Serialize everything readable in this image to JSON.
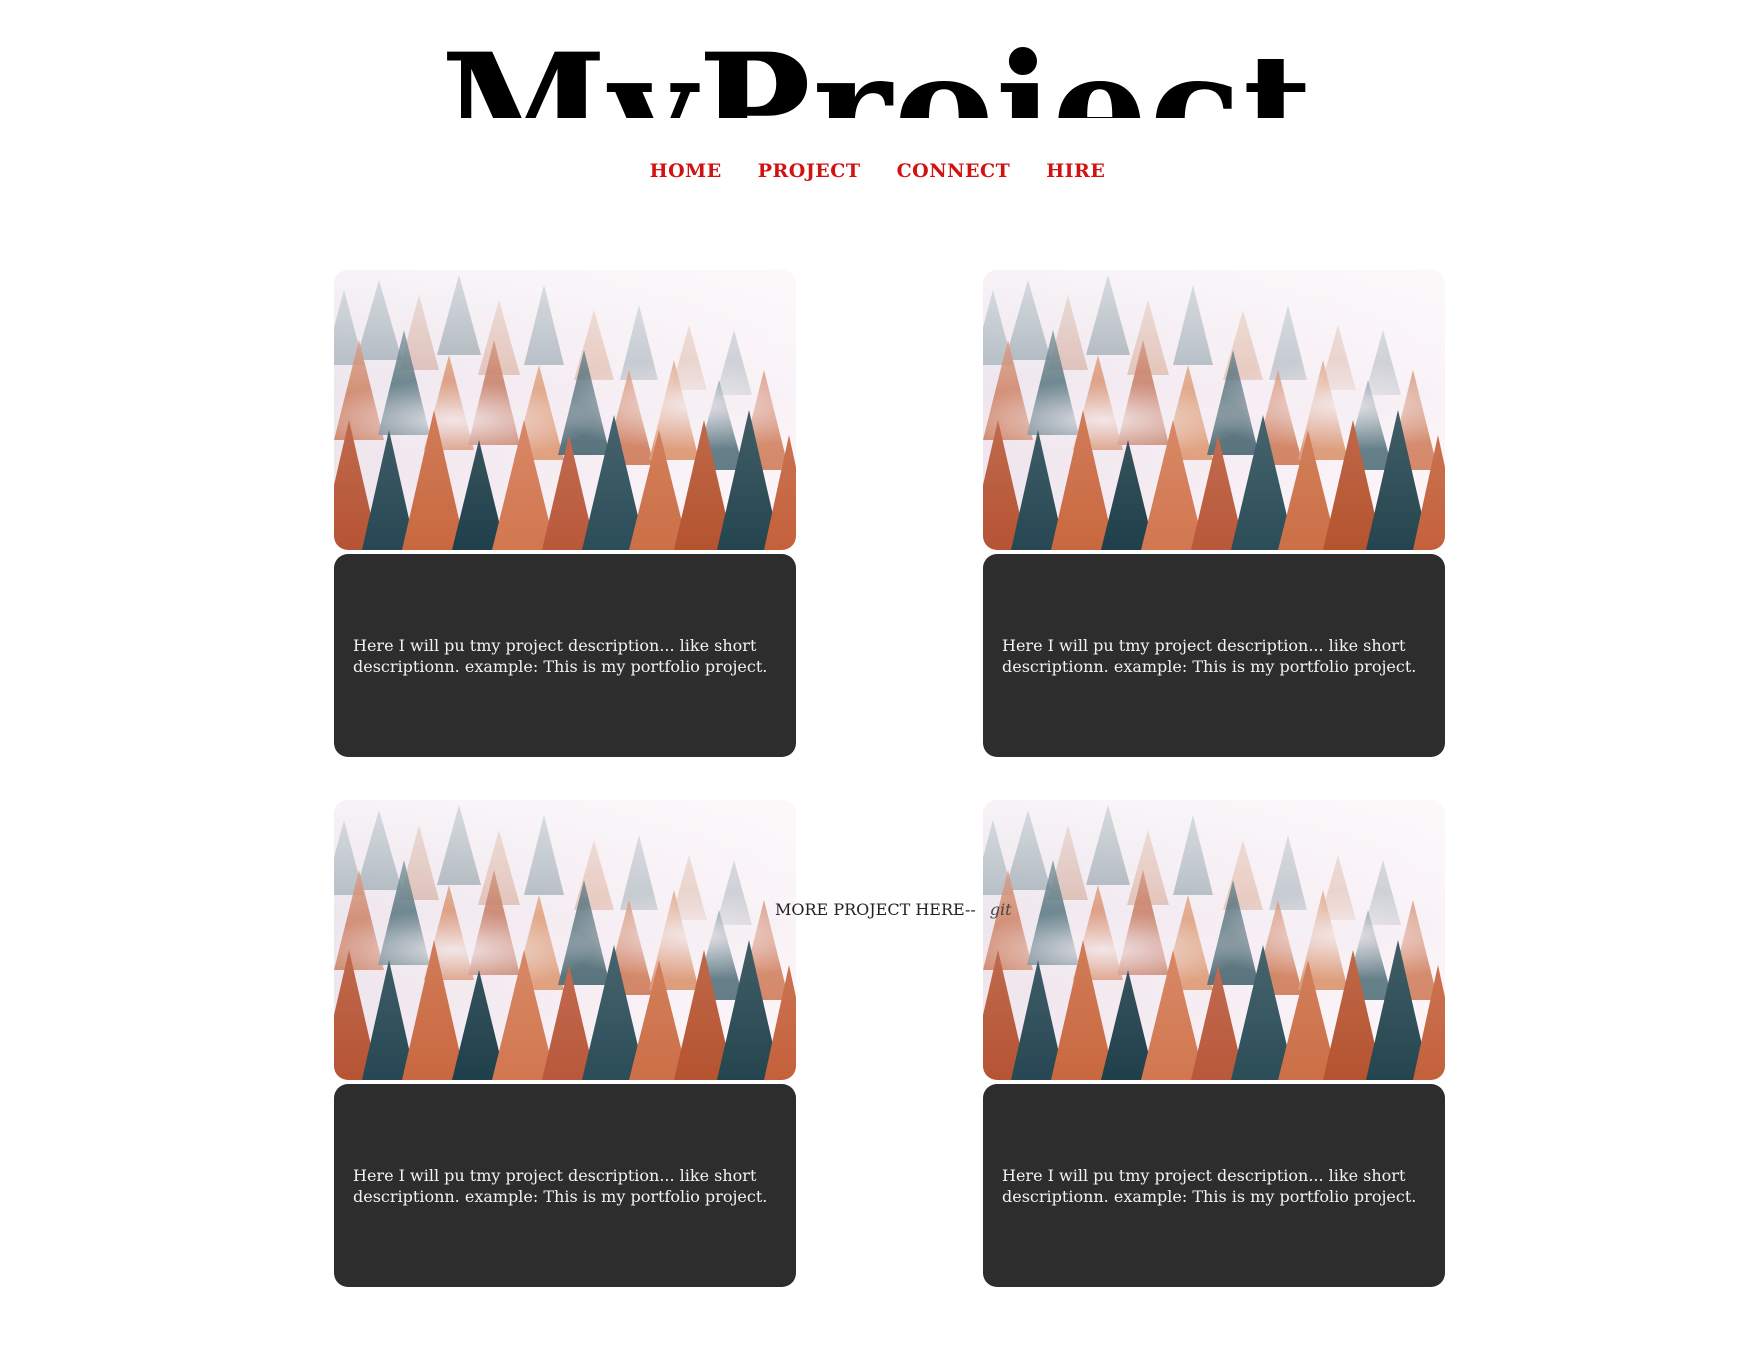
{
  "header": {
    "title": "MyProject"
  },
  "nav": {
    "items": [
      {
        "label": "HOME"
      },
      {
        "label": "PROJECT"
      },
      {
        "label": "CONNECT"
      },
      {
        "label": "HIRE"
      }
    ],
    "color": "#d11212"
  },
  "projects": [
    {
      "description": "Here I will pu tmy project description... like short descriptionn. example: This is my portfolio project.",
      "image": "misty-autumn-forest-image"
    },
    {
      "description": "Here I will pu tmy project description... like short descriptionn. example: This is my portfolio project.",
      "image": "misty-autumn-forest-image"
    },
    {
      "description": "Here I will pu tmy project description... like short descriptionn. example: This is my portfolio project.",
      "image": "misty-autumn-forest-image"
    },
    {
      "description": "Here I will pu tmy project description... like short descriptionn. example: This is my portfolio project.",
      "image": "misty-autumn-forest-image"
    }
  ],
  "more": {
    "label": "MORE PROJECT HERE--",
    "link": "git"
  },
  "colors": {
    "card_background": "#2d2d2d",
    "card_text": "#f2f2f2"
  }
}
